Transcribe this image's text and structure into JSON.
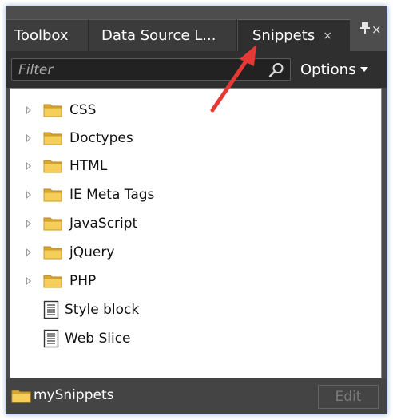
{
  "tabs": [
    {
      "label": "Toolbox"
    },
    {
      "label": "Data Source L..."
    },
    {
      "label": "Snippets",
      "close": "×",
      "active": true
    }
  ],
  "panel_controls": {
    "pin_icon": "pin-icon",
    "close": "×"
  },
  "filter": {
    "placeholder": "Filter",
    "value": "",
    "icon": "search-icon"
  },
  "options": {
    "label": "Options"
  },
  "tree": {
    "items": [
      {
        "label": "CSS",
        "type": "folder",
        "expandable": true
      },
      {
        "label": "Doctypes",
        "type": "folder",
        "expandable": true
      },
      {
        "label": "HTML",
        "type": "folder",
        "expandable": true
      },
      {
        "label": "IE Meta Tags",
        "type": "folder",
        "expandable": true
      },
      {
        "label": "JavaScript",
        "type": "folder",
        "expandable": true
      },
      {
        "label": "jQuery",
        "type": "folder",
        "expandable": true
      },
      {
        "label": "PHP",
        "type": "folder",
        "expandable": true
      },
      {
        "label": "Style block",
        "type": "snippet",
        "expandable": false
      },
      {
        "label": "Web Slice",
        "type": "snippet",
        "expandable": false
      }
    ]
  },
  "bottom": {
    "folder_label": "mySnippets",
    "edit_label": "Edit"
  },
  "colors": {
    "panel_dark": "#4a4a4a",
    "filter_bar": "#2f2f2f",
    "folder_yellow": "#f0c74c",
    "annotation_red": "#e53935"
  }
}
